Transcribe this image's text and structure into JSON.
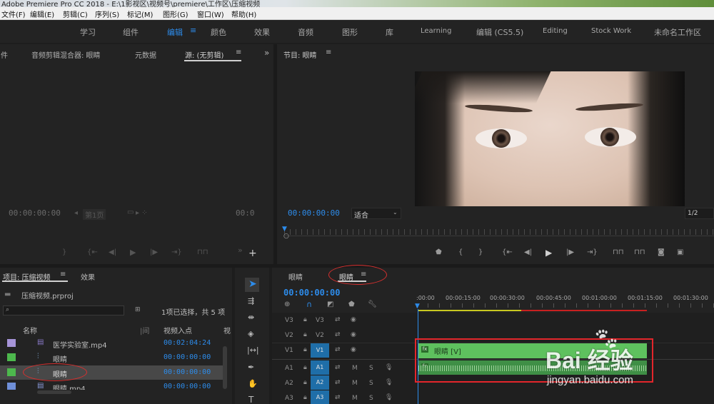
{
  "window": {
    "title": "Adobe Premiere Pro CC 2018 - E:\\1影视区\\视频号\\premiere\\工作区\\压缩视频"
  },
  "menu": [
    "文件(F)",
    "编辑(E)",
    "剪辑(C)",
    "序列(S)",
    "标记(M)",
    "图形(G)",
    "窗口(W)",
    "帮助(H)"
  ],
  "workspaces": {
    "items": [
      "学习",
      "组件",
      "编辑",
      "颜色",
      "效果",
      "音频",
      "图形",
      "库",
      "Learning",
      "编辑 (CS5.5)",
      "Editing",
      "Stock Work",
      "未命名工作区"
    ],
    "active": "编辑"
  },
  "source_panel": {
    "tabs": [
      "件",
      "音频剪辑混合器: 眼睛",
      "元数据",
      "源: (无剪辑)"
    ],
    "active_tab": "源: (无剪辑)",
    "timecode_in": "00:00:00:00",
    "timecode_out": "00:0",
    "page": "第1页"
  },
  "program_panel": {
    "title": "节目: 眼睛",
    "timecode": "00:00:00:00",
    "fit": "适合",
    "resolution": "1/2"
  },
  "project_panel": {
    "tabs": [
      "项目: 压缩视频",
      "效果"
    ],
    "project_file": "压缩视频.prproj",
    "selection_status": "1项已选择，共 5 项",
    "columns": [
      "名称",
      "视频入点",
      "视"
    ],
    "items": [
      {
        "name": "医学实验室.mp4",
        "in_point": "00:02:04:24",
        "color": "#a694d8",
        "type": "video"
      },
      {
        "name": "眼睛",
        "in_point": "00:00:00:00",
        "color": "#4db84d",
        "type": "sequence"
      },
      {
        "name": "眼睛",
        "in_point": "00:00:00:00",
        "color": "#4db84d",
        "type": "sequence",
        "selected": true
      },
      {
        "name": "眼睛.mp4",
        "in_point": "00:00:00:00",
        "color": "#6f8fd8",
        "type": "video"
      }
    ]
  },
  "timeline": {
    "tabs": [
      "眼睛",
      "眼睛"
    ],
    "active_tab_index": 1,
    "timecode": "00:00:00:00",
    "ruler": [
      ":00:00",
      "00:00:15:00",
      "00:00:30:00",
      "00:00:45:00",
      "00:01:00:00",
      "00:01:15:00",
      "00:01:30:00"
    ],
    "tracks": [
      {
        "name": "V3",
        "target": "V3"
      },
      {
        "name": "V2",
        "target": "V2"
      },
      {
        "name": "V1",
        "target": "V1"
      },
      {
        "name": "A1",
        "target": "A1"
      },
      {
        "name": "A2",
        "target": "A2"
      },
      {
        "name": "A3",
        "target": "A3"
      }
    ],
    "video_clip_label": "眼睛 [V]",
    "track_buttons": [
      "M",
      "S"
    ]
  },
  "watermark": {
    "brand": "Bai 经验",
    "url": "jingyan.baidu.com"
  }
}
